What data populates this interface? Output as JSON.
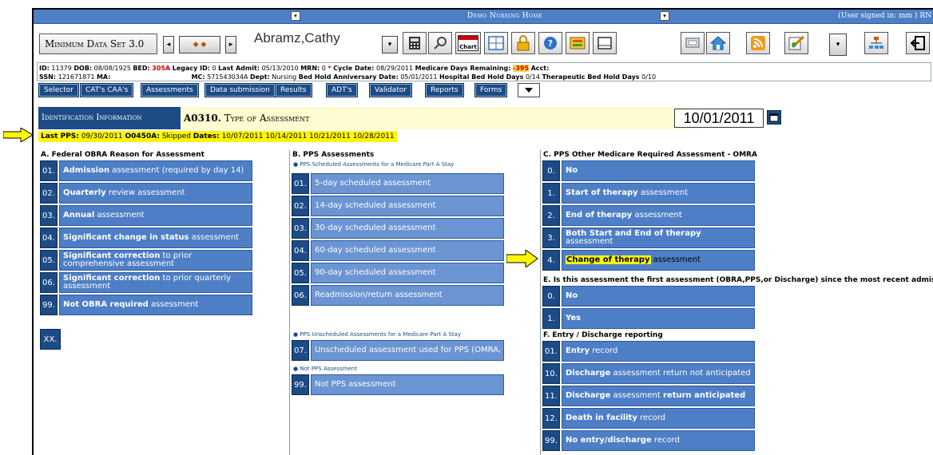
{
  "titlebar": {
    "center": "Demo Nursing Home",
    "user": "(User signed in: mm ) RN"
  },
  "toolbar": {
    "mds_label": "Minimum Data Set 3.0",
    "patient_name": "Abramz,Cathy",
    "chart_label": "Chart"
  },
  "info": {
    "id_label": "ID:",
    "id": "11379",
    "dob_label": "DOB:",
    "dob": "08/08/1925",
    "bed_label": "BED:",
    "bed": "305A",
    "legacy_label": "Legacy ID:",
    "legacy": "0",
    "last_admit_label": "Last Admit:",
    "last_admit": "05/13/2010",
    "mrn_label": "MRN:",
    "mrn": "0",
    "star": "*",
    "cycle_label": "Cycle Date:",
    "cycle": "08/29/2011",
    "medicare_label": "Medicare Days Remaining:",
    "medicare": "-395",
    "acct_label": "Acct:",
    "ssn_label": "SSN:",
    "ssn": "121671871",
    "ma_label": "MA:",
    "mc_label": "MC:",
    "mc": "571543034A",
    "dept_label": "Dept:",
    "dept": "Nursing",
    "anniv_label": "Bed Hold Anniversary Date:",
    "anniv": "05/01/2011",
    "hosp_label": "Hospital Bed Hold Days",
    "hosp": "0/14",
    "ther_label": "Therapeutic Bed Hold Days",
    "ther": "0/10"
  },
  "nav": [
    "Selector",
    "CAT's CAA's",
    "Assessments",
    "Data submission",
    "Results",
    "ADT's",
    "Validator",
    "Reports",
    "Forms"
  ],
  "section": {
    "left": "Identification Information",
    "code": "A0310.",
    "title": "Type of Assessment",
    "date": "10/01/2011",
    "lastpps_label": "Last PPS:",
    "lastpps": "09/30/2011",
    "o0450a_label": "O0450A:",
    "o0450a": "Skipped",
    "dates_label": "Dates:",
    "dates": "10/07/2011 10/14/2011 10/21/2011 10/28/2011"
  },
  "col_a": {
    "header": "A. Federal OBRA Reason for Assessment",
    "items": [
      {
        "code": "01.",
        "bold": "Admission",
        "rest": " assessment (required by day 14)"
      },
      {
        "code": "02.",
        "bold": "Quarterly",
        "rest": " review assessment"
      },
      {
        "code": "03.",
        "bold": "Annual",
        "rest": " assessment"
      },
      {
        "code": "04.",
        "bold": "Significant change in status",
        "rest": " assessment"
      },
      {
        "code": "05.",
        "bold": "Significant correction",
        "rest": " to prior comprehensive assessment"
      },
      {
        "code": "06.",
        "bold": "Significant correction",
        "rest": " to prior quarterly assessment"
      },
      {
        "code": "99.",
        "bold": "Not OBRA required",
        "rest": " assessment"
      }
    ],
    "xx": "XX."
  },
  "col_b": {
    "header": "B. PPS Assessments",
    "bullet1": "PPS Scheduled Assessments for a Medicare Part A Stay",
    "items": [
      {
        "code": "01.",
        "label": "5-day scheduled assessment"
      },
      {
        "code": "02.",
        "label": "14-day scheduled assessment"
      },
      {
        "code": "03.",
        "label": "30-day scheduled assessment"
      },
      {
        "code": "04.",
        "label": "60-day scheduled assessment"
      },
      {
        "code": "05.",
        "label": "90-day scheduled assessment"
      },
      {
        "code": "06.",
        "label": "Readmission/return assessment"
      }
    ],
    "bullet2": "PPS Unscheduled Assessments for a Medicare Part A Stay",
    "item07": {
      "code": "07.",
      "label": "Unscheduled assessment used for PPS (OMRA, signific"
    },
    "bullet3": "Not PPS Assessment",
    "item99": {
      "code": "99.",
      "label": "Not PPS assessment"
    }
  },
  "col_c": {
    "header": "C. PPS Other Medicare Required Assessment - OMRA",
    "items": [
      {
        "code": "0.",
        "bold": "No",
        "rest": ""
      },
      {
        "code": "1.",
        "bold": "Start of therapy",
        "rest": " assessment"
      },
      {
        "code": "2.",
        "bold": "End of therapy",
        "rest": " assessment"
      },
      {
        "code": "3.",
        "bold": "Both Start and End of therapy",
        "rest": " assessment"
      },
      {
        "code": "4.",
        "bold": "Change of therapy",
        "rest": " assessment"
      }
    ],
    "header_e": "E. Is this assessment the first assessment (OBRA,PPS,or Discharge) since the most recent admission?",
    "items_e": [
      {
        "code": "0.",
        "bold": "No"
      },
      {
        "code": "1.",
        "bold": "Yes"
      }
    ],
    "header_f": "F. Entry / Discharge reporting",
    "items_f": [
      {
        "code": "01.",
        "bold": "Entry",
        "rest": " record"
      },
      {
        "code": "10.",
        "bold": "Discharge",
        "rest": " assessment return not anticipated"
      },
      {
        "code": "11.",
        "bold": "Discharge",
        "rest": " assessment ",
        "bold2": "return anticipated"
      },
      {
        "code": "12.",
        "bold": "Death in facility",
        "rest": " record"
      },
      {
        "code": "99.",
        "bold": "No entry/discharge",
        "rest": " record"
      }
    ]
  },
  "colors": {
    "dark_blue": "#1c4b86",
    "mid_blue": "#4e7fc6",
    "highlight_yellow": "#fff700"
  }
}
